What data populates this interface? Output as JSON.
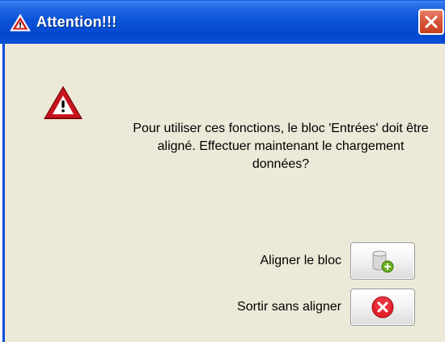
{
  "dialog": {
    "title": "Attention!!!",
    "message": "Pour utiliser ces fonctions, le bloc 'Entrées' doit être\naligné. Effectuer maintenant le chargement\ndonnées?",
    "actions": {
      "align_label": "Aligner le bloc",
      "exit_label": "Sortir sans aligner"
    },
    "icons": {
      "title": "warning-icon",
      "main": "warning-icon",
      "align": "database-add-icon",
      "exit": "cancel-icon",
      "close": "close-icon"
    },
    "colors": {
      "titlebar": "#0a4fd6",
      "close": "#d8563a",
      "background": "#ece9d8",
      "warning_red": "#c8141e",
      "cancel_red": "#e2202a",
      "add_green": "#6aae1f"
    }
  }
}
